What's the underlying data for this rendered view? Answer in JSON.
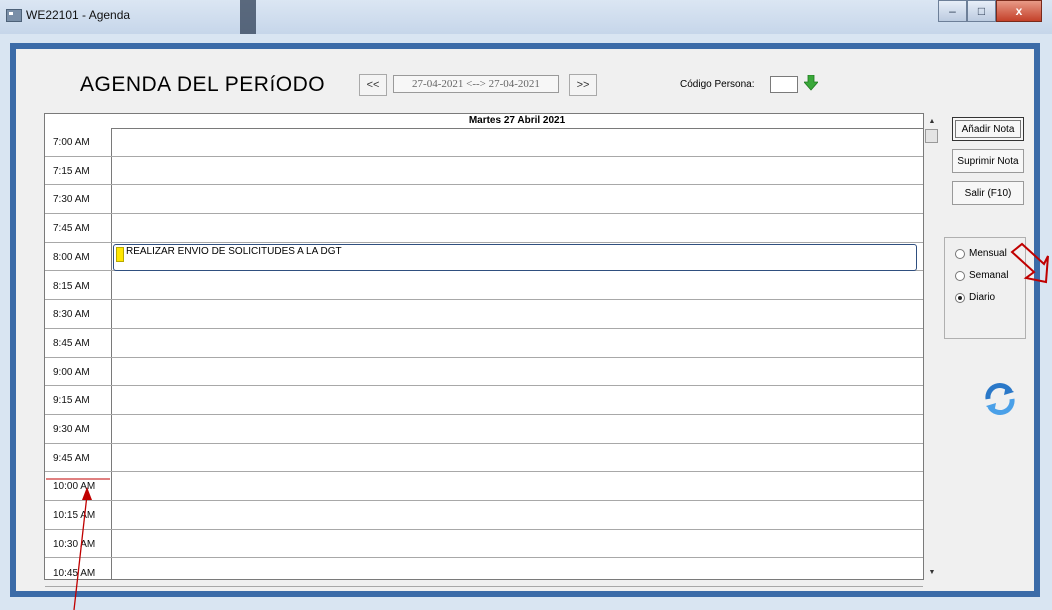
{
  "window": {
    "title": "WE22101 - Agenda",
    "close_glyph": "x",
    "minimize_glyph": "–",
    "maximize_glyph": "□"
  },
  "header": {
    "title": "AGENDA DEL PERíODO",
    "prev_label": "<<",
    "next_label": ">>",
    "range": "27-04-2021 <--> 27-04-2021",
    "codigo_label": "Código Persona:",
    "codigo_value": ""
  },
  "calendar": {
    "day_header": "Martes 27 Abril 2021",
    "times": [
      "7:00 AM",
      "7:15 AM",
      "7:30 AM",
      "7:45 AM",
      "8:00 AM",
      "8:15 AM",
      "8:30 AM",
      "8:45 AM",
      "9:00 AM",
      "9:15 AM",
      "9:30 AM",
      "9:45 AM",
      "10:00 AM",
      "10:15 AM",
      "10:30 AM",
      "10:45 AM"
    ],
    "event": {
      "time": "8:00 AM",
      "text": "REALIZAR ENVIO DE SOLICITUDES A LA DGT",
      "flag_color": "#ffe600"
    }
  },
  "sidebar": {
    "add_note": "Añadir Nota",
    "delete_note": "Suprimir Nota",
    "exit": "Salir (F10)",
    "views": [
      {
        "label": "Mensual",
        "selected": false
      },
      {
        "label": "Semanal",
        "selected": false
      },
      {
        "label": "Diario",
        "selected": true
      }
    ]
  },
  "colors": {
    "frame_blue": "#3b6ba8",
    "annotation_red": "#c00000",
    "arrow_green": "#3aa83a"
  }
}
